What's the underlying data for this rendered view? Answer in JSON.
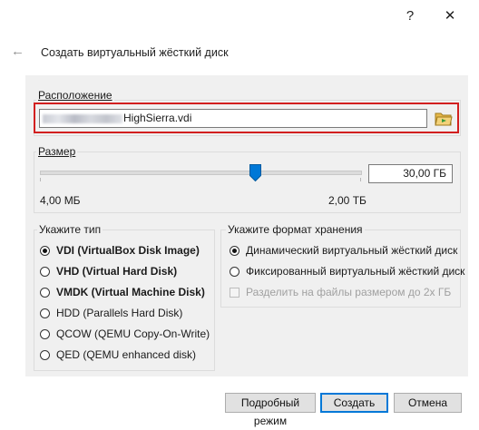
{
  "window": {
    "help_glyph": "?",
    "close_glyph": "✕",
    "back_glyph": "←",
    "title": "Создать виртуальный жёсткий диск"
  },
  "location": {
    "legend": "Расположение",
    "path_visible": "HighSierra.vdi"
  },
  "size": {
    "legend": "Размер",
    "value": "30,00 ГБ",
    "min_label": "4,00 МБ",
    "max_label": "2,00 ТБ",
    "slider_fraction": 0.68
  },
  "type": {
    "legend": "Укажите тип",
    "options": [
      {
        "label": "VDI (VirtualBox Disk Image)",
        "selected": true
      },
      {
        "label": "VHD (Virtual Hard Disk)",
        "selected": false
      },
      {
        "label": "VMDK (Virtual Machine Disk)",
        "selected": false
      },
      {
        "label": "HDD (Parallels Hard Disk)",
        "selected": false
      },
      {
        "label": "QCOW (QEMU Copy-On-Write)",
        "selected": false
      },
      {
        "label": "QED (QEMU enhanced disk)",
        "selected": false
      }
    ]
  },
  "storage": {
    "legend": "Укажите формат хранения",
    "options": [
      {
        "label": "Динамический виртуальный жёсткий диск",
        "selected": true
      },
      {
        "label": "Фиксированный виртуальный жёсткий диск",
        "selected": false
      }
    ],
    "split_label": "Разделить на файлы размером до 2х ГБ"
  },
  "buttons": {
    "expert": "Подробный режим",
    "create": "Создать",
    "cancel": "Отмена"
  },
  "colors": {
    "highlight": "#d21f1f",
    "accent": "#0078d7",
    "panel_bg": "#f0f0f0"
  }
}
